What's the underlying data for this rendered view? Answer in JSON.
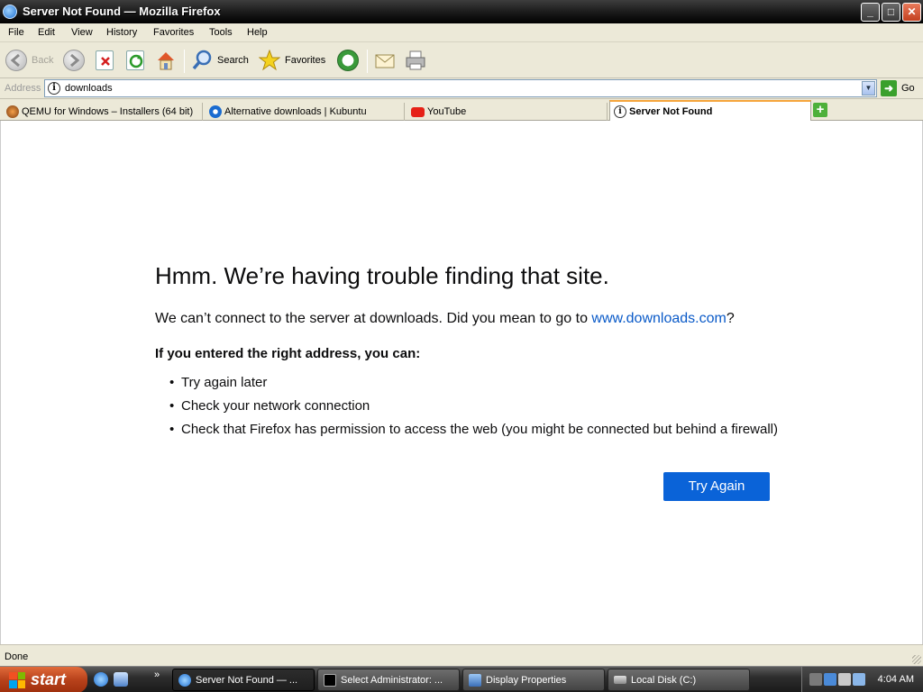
{
  "window": {
    "title": "Server Not Found — Mozilla Firefox",
    "controls": {
      "minimize": "_",
      "maximize": "□",
      "close": "✕"
    }
  },
  "menu": [
    "File",
    "Edit",
    "View",
    "History",
    "Favorites",
    "Tools",
    "Help"
  ],
  "toolbar": {
    "back_label": "Back",
    "search_label": "Search",
    "favorites_label": "Favorites"
  },
  "address": {
    "label": "Address",
    "value": "downloads",
    "go_label": "Go"
  },
  "tabs": [
    {
      "label": "QEMU for Windows – Installers (64 bit)",
      "active": false
    },
    {
      "label": "Alternative downloads | Kubuntu",
      "active": false
    },
    {
      "label": "YouTube",
      "active": false
    },
    {
      "label": "Server Not Found",
      "active": true
    }
  ],
  "error_page": {
    "title": "Hmm. We’re having trouble finding that site.",
    "desc_prefix": "We can’t connect to the server at downloads. Did you mean to go to ",
    "desc_link": "www.downloads.com",
    "desc_suffix": "?",
    "subheading": "If you entered the right address, you can:",
    "tips": [
      "Try again later",
      "Check your network connection",
      "Check that Firefox has permission to access the web (you might be connected but behind a firewall)"
    ],
    "button": "Try Again"
  },
  "status": "Done",
  "taskbar": {
    "start": "start",
    "more": "»",
    "tasks": [
      {
        "label": "Server Not Found — ...",
        "active": true
      },
      {
        "label": "Select Administrator: ...",
        "active": false
      },
      {
        "label": "Display Properties",
        "active": false
      },
      {
        "label": "Local Disk (C:)",
        "active": false
      }
    ],
    "clock": "4:04 AM"
  },
  "colors": {
    "accent_blue": "#0a63d8",
    "link": "#0a5ac8",
    "active_tab_top": "#f6a53c",
    "start_button": "#b8421b"
  }
}
